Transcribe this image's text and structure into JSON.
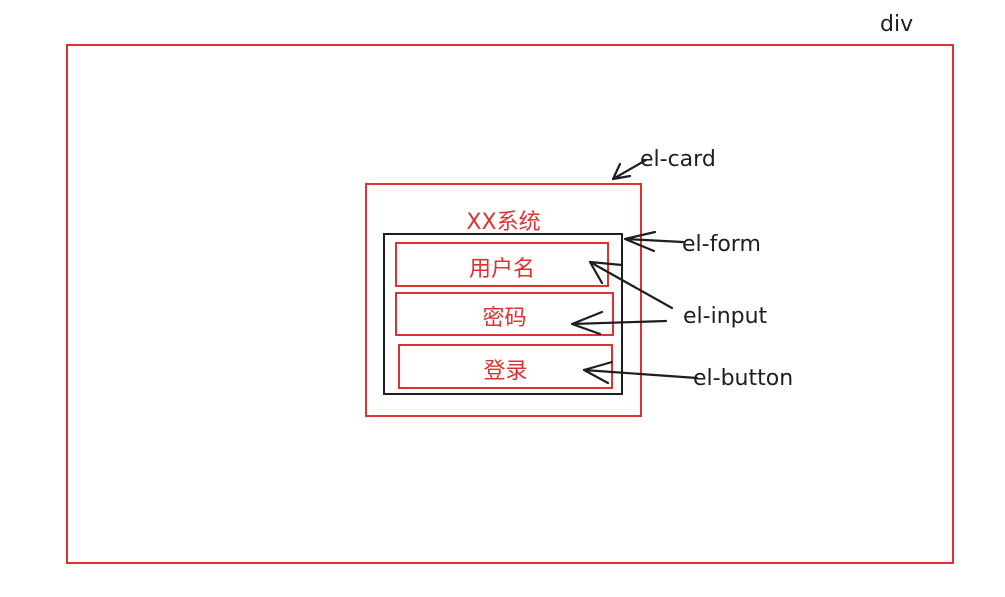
{
  "labels": {
    "div": "div",
    "card": "el-card",
    "form": "el-form",
    "input": "el-input",
    "button": "el-button"
  },
  "card": {
    "title": "XX系统",
    "username": "用户名",
    "password": "密码",
    "login": "登录"
  },
  "colors": {
    "red": "#e03131",
    "black": "#1e1e1e"
  }
}
